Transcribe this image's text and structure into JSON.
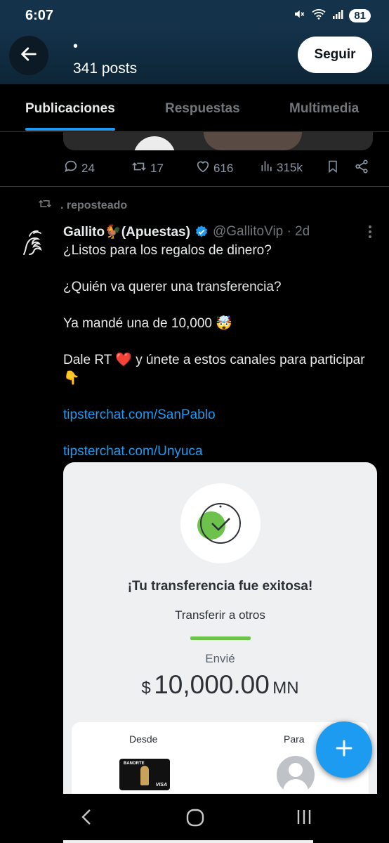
{
  "status_bar": {
    "time": "6:07",
    "battery": "81",
    "icons": [
      "mute-icon",
      "wifi-icon",
      "signal-icon"
    ]
  },
  "header": {
    "display_name": "•",
    "posts_count": "341 posts",
    "follow_label": "Seguir"
  },
  "tabs": [
    {
      "label": "Publicaciones",
      "active": true
    },
    {
      "label": "Respuestas",
      "active": false
    },
    {
      "label": "Multimedia",
      "active": false
    }
  ],
  "prev_tweet_actions": {
    "replies": "24",
    "reposts": "17",
    "likes": "616",
    "views": "315k"
  },
  "repost_label": ". reposteado",
  "tweet": {
    "name": "Gallito🐓(Apuestas)",
    "handle": "@GallitoVip · 2d",
    "lines": [
      "¿Listos para los regalos de dinero?",
      "¿Quién va querer una transferencia?",
      "Ya mandé una de 10,000 🤯",
      "Dale RT ❤️ y únete a estos canales para participar 👇"
    ],
    "links": [
      "tipsterchat.com/SanPablo",
      "tipsterchat.com/Unyuca"
    ]
  },
  "transfer_card": {
    "title": "¡Tu transferencia fue exitosa!",
    "subtitle": "Transferir a otros",
    "sent_label": "Envié",
    "currency": "$",
    "amount": "10,000.00",
    "currency_code": "MN",
    "from_label": "Desde",
    "to_label": "Para",
    "bank_card_name": "BANORTE",
    "bank_card_network": "VISA"
  },
  "colors": {
    "accent": "#1d9bf0",
    "header_bg": "#14324a",
    "success_green": "#6cc24a"
  }
}
